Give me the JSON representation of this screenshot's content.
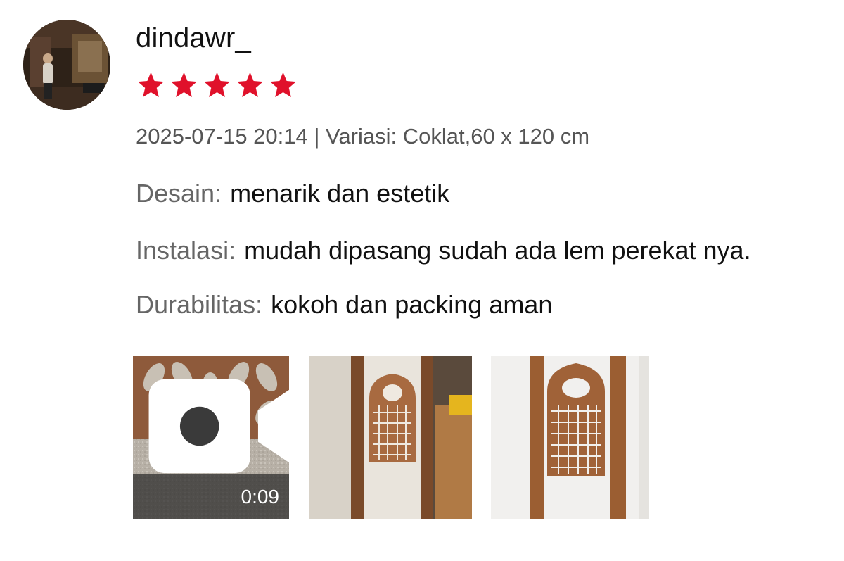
{
  "review": {
    "username": "dindawr_",
    "rating": 5,
    "rating_max": 5,
    "star_color": "#e0112b",
    "meta": "2025-07-15 20:14 | Variasi: Coklat,60 x 120 cm",
    "attributes": [
      {
        "label": "Desain:",
        "value": "menarik dan estetik"
      },
      {
        "label": "Instalasi:",
        "value": "mudah dipasang sudah ada lem perekat nya."
      },
      {
        "label": "Durabilitas:",
        "value": "kokoh dan packing aman"
      }
    ],
    "media": [
      {
        "type": "video",
        "duration": "0:09",
        "icon": "video-camera-icon"
      },
      {
        "type": "photo"
      },
      {
        "type": "photo"
      }
    ]
  }
}
